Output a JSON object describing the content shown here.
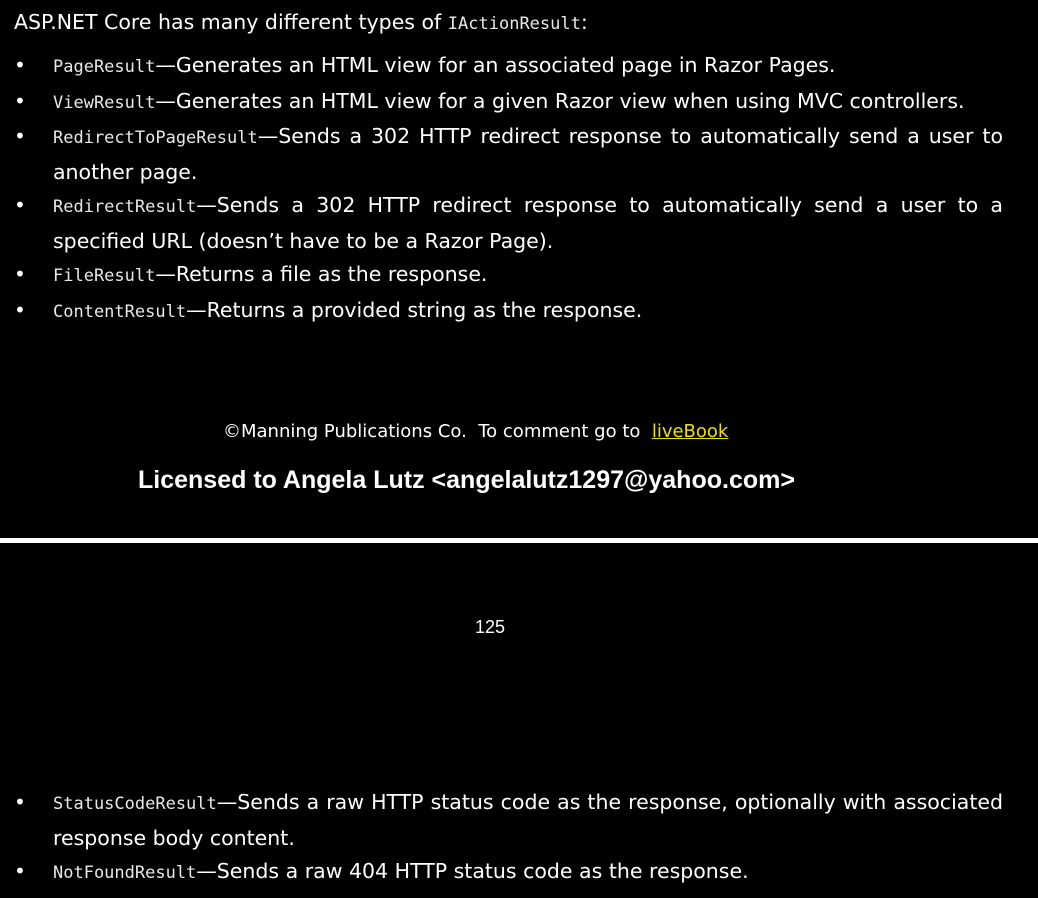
{
  "intro": {
    "text_before": "ASP.NET Core has many different types of ",
    "code": "IActionResult",
    "text_after": ":"
  },
  "list_top": [
    {
      "code": "PageResult",
      "text": "—Generates an HTML view for an associated page in Razor Pages."
    },
    {
      "code": "ViewResult",
      "text": "—Generates an HTML view for a given Razor view when using MVC controllers."
    },
    {
      "code": "RedirectToPageResult",
      "text": "—Sends a 302 HTTP redirect response to automatically send a user to another page."
    },
    {
      "code": "RedirectResult",
      "text": "—Sends a 302 HTTP redirect response to automatically send a user to a specified URL (doesn’t have to be a Razor Page)."
    },
    {
      "code": "FileResult",
      "text": "—Returns a file as the response."
    },
    {
      "code": "ContentResult",
      "text": "—Returns a provided string as the response."
    }
  ],
  "footer": {
    "copyright": "©Manning Publications Co.  To comment go to  ",
    "link_label": "liveBook",
    "license": "Licensed to Angela Lutz <angelalutz1297@yahoo.com>"
  },
  "page_number": "125",
  "list_bottom": [
    {
      "code": "StatusCodeResult",
      "text": "—Sends a raw HTTP status code as the response, optionally with associated response body content."
    },
    {
      "code": "NotFoundResult",
      "text": "—Sends a raw 404 HTTP status code as the response."
    }
  ],
  "bullet_glyph": "•",
  "colors": {
    "background": "#000000",
    "text": "#ffffff",
    "link": "#f0e000"
  }
}
